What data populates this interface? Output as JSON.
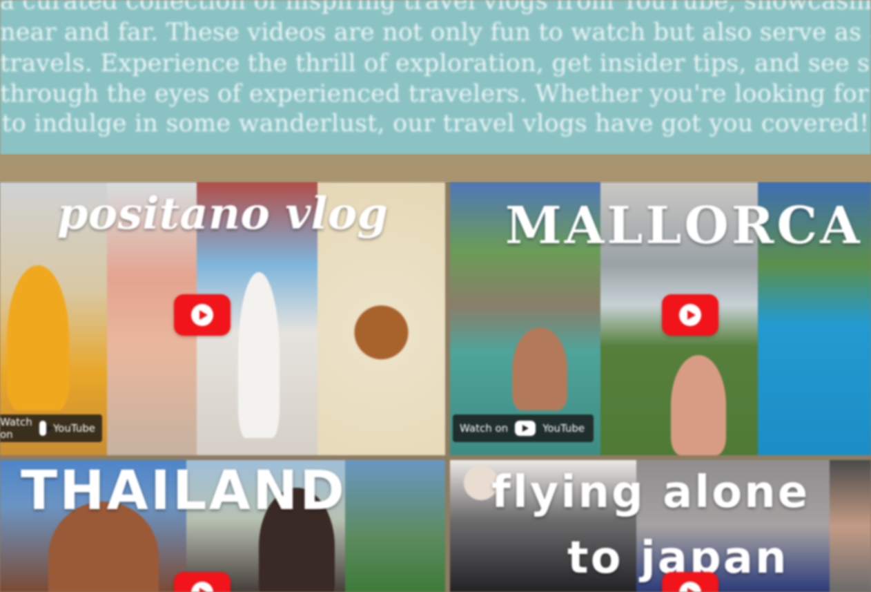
{
  "intro": {
    "lines": [
      "a curated collection of inspiring travel vlogs from YouTube, showcasing destinations",
      "near and far. These videos are not only fun to watch but also serve as a great source of",
      "travels. Experience the thrill of exploration, get insider tips, and see stunning landscapes",
      "through the eyes of experienced travelers. Whether you're looking for your next travel d",
      "to indulge in some wanderlust, our travel vlogs have got you covered!"
    ],
    "text_color": "#eef7f6",
    "background": "#8bc3c5"
  },
  "videos": [
    {
      "overlay_title": "positano vlog",
      "watch_label": "Watch on",
      "youtube_label": "YouTube",
      "play_icon": "youtube-play-icon"
    },
    {
      "overlay_title": "MALLORCA",
      "watch_label": "Watch on",
      "youtube_label": "YouTube",
      "play_icon": "youtube-play-icon"
    },
    {
      "overlay_title": "THAILAND",
      "play_icon": "youtube-play-icon"
    },
    {
      "overlay_title_line1": "flying alone",
      "overlay_title_line2": "to japan",
      "play_icon": "youtube-play-icon"
    }
  ],
  "colors": {
    "band": "#a8946f",
    "youtube_red": "#f1141a"
  }
}
